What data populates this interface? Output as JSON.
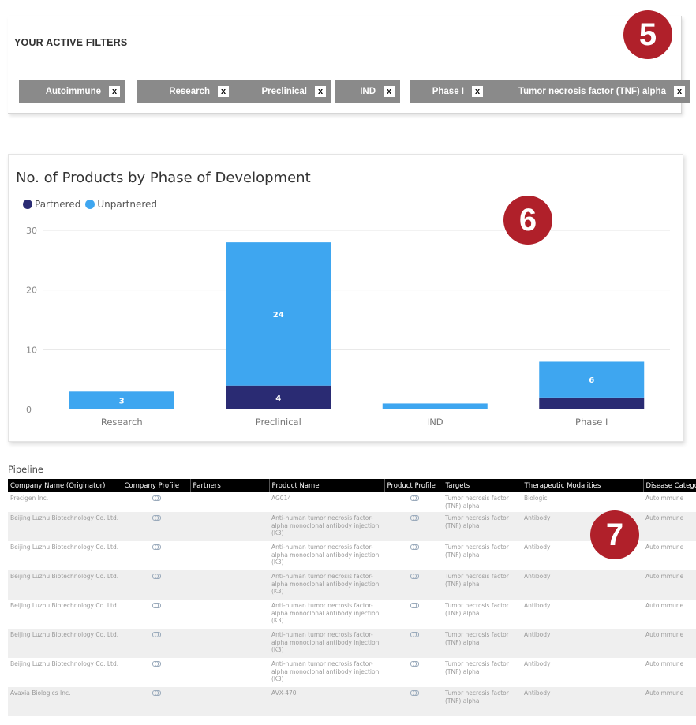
{
  "filters": {
    "title": "YOUR ACTIVE FILTERS",
    "chips": [
      {
        "label": "Autoimmune"
      },
      {
        "label": "Research"
      },
      {
        "label": "Preclinical"
      },
      {
        "label": "IND"
      },
      {
        "label": "Phase I"
      },
      {
        "label": "Tumor necrosis factor (TNF) alpha"
      }
    ],
    "close_glyph": "x"
  },
  "badges": {
    "five": "5",
    "six": "6",
    "seven": "7"
  },
  "colors": {
    "partnered": "#2a2b73",
    "unpartnered": "#3ea6f0",
    "badge": "#b0202a",
    "chip": "#8a8a8a"
  },
  "chart": {
    "title": "No. of Products by Phase of Development",
    "legend": [
      {
        "name": "Partnered",
        "color": "#2a2b73"
      },
      {
        "name": "Unpartnered",
        "color": "#3ea6f0"
      }
    ]
  },
  "chart_data": {
    "type": "bar",
    "stacked": true,
    "title": "No. of Products by Phase of Development",
    "categories": [
      "Research",
      "Preclinical",
      "IND",
      "Phase I"
    ],
    "series": [
      {
        "name": "Partnered",
        "values": [
          0,
          4,
          0,
          2
        ],
        "labels": [
          "",
          "4",
          "",
          ""
        ]
      },
      {
        "name": "Unpartnered",
        "values": [
          3,
          24,
          1,
          6
        ],
        "labels": [
          "3",
          "24",
          "",
          "6"
        ]
      }
    ],
    "ylim": [
      0,
      30
    ],
    "yticks": [
      0,
      10,
      20,
      30
    ],
    "grid": true,
    "legend_position": "top-left"
  },
  "pipeline": {
    "label": "Pipeline",
    "columns": [
      "Company Name (Originator)",
      "Company Profile",
      "Partners",
      "Product Name",
      "Product Profile",
      "Targets",
      "Therapeutic Modalities",
      "Disease Category"
    ],
    "rows": [
      {
        "company": "Precigen Inc.",
        "partners": "",
        "product": "AG014",
        "targets": "Tumor necrosis factor (TNF) alpha",
        "modality": "Biologic",
        "disease": "Autoimmune"
      },
      {
        "company": "Beijing Luzhu Biotechnology Co. Ltd.",
        "partners": "",
        "product": "Anti-human tumor necrosis factor-alpha monoclonal antibody injection (K3)",
        "targets": "Tumor necrosis factor (TNF) alpha",
        "modality": "Antibody",
        "disease": "Autoimmune"
      },
      {
        "company": "Beijing Luzhu Biotechnology Co. Ltd.",
        "partners": "",
        "product": "Anti-human tumor necrosis factor-alpha monoclonal antibody injection (K3)",
        "targets": "Tumor necrosis factor (TNF) alpha",
        "modality": "Antibody",
        "disease": "Autoimmune"
      },
      {
        "company": "Beijing Luzhu Biotechnology Co. Ltd.",
        "partners": "",
        "product": "Anti-human tumor necrosis factor-alpha monoclonal antibody injection (K3)",
        "targets": "Tumor necrosis factor (TNF) alpha",
        "modality": "Antibody",
        "disease": "Autoimmune"
      },
      {
        "company": "Beijing Luzhu Biotechnology Co. Ltd.",
        "partners": "",
        "product": "Anti-human tumor necrosis factor-alpha monoclonal antibody injection (K3)",
        "targets": "Tumor necrosis factor (TNF) alpha",
        "modality": "Antibody",
        "disease": "Autoimmune"
      },
      {
        "company": "Beijing Luzhu Biotechnology Co. Ltd.",
        "partners": "",
        "product": "Anti-human tumor necrosis factor-alpha monoclonal antibody injection (K3)",
        "targets": "Tumor necrosis factor (TNF) alpha",
        "modality": "Antibody",
        "disease": "Autoimmune"
      },
      {
        "company": "Beijing Luzhu Biotechnology Co. Ltd.",
        "partners": "",
        "product": "Anti-human tumor necrosis factor-alpha monoclonal antibody injection (K3)",
        "targets": "Tumor necrosis factor (TNF) alpha",
        "modality": "Antibody",
        "disease": "Autoimmune"
      },
      {
        "company": "Avaxia Biologics Inc.",
        "partners": "",
        "product": "AVX-470",
        "targets": "Tumor necrosis factor (TNF) alpha",
        "modality": "Antibody",
        "disease": "Autoimmune"
      }
    ]
  }
}
